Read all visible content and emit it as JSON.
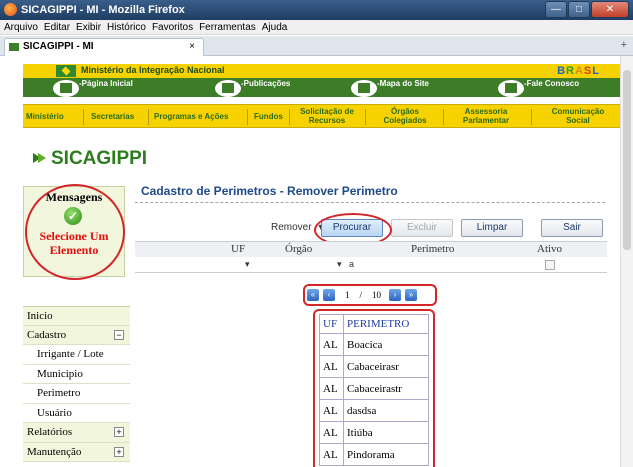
{
  "window": {
    "title": "SICAGIPPI - MI - Mozilla Firefox",
    "buttons": {
      "minimize": "—",
      "maximize": "□",
      "close": "✕"
    }
  },
  "menubar": [
    "Arquivo",
    "Editar",
    "Exibir",
    "Histórico",
    "Favoritos",
    "Ferramentas",
    "Ajuda"
  ],
  "tab": {
    "label": "SICAGIPPI - MI",
    "close": "×",
    "new_tab": "+"
  },
  "gov": {
    "ministry": "Ministério da Integração Nacional",
    "brand": [
      "B",
      "R",
      "A",
      "S",
      "L"
    ],
    "nav": [
      "-Página Inicial",
      "-Publicações",
      "-Mapa do Site",
      "-Fale Conosco"
    ]
  },
  "section_nav": [
    "Ministério",
    "Secretarias",
    "Programas e Ações",
    "Fundos",
    "Solicitação de Recursos",
    "Órgãos Colegiados",
    "Assessoria Parlamentar",
    "Comunicação Social"
  ],
  "logo": {
    "text": "SICAGIPPI"
  },
  "messages": {
    "title": "Mensagens",
    "text": "Selecione Um Elemento"
  },
  "left_menu": [
    {
      "label": "Inicio",
      "sub": false,
      "toggle": ""
    },
    {
      "label": "Cadastro",
      "sub": false,
      "toggle": "−"
    },
    {
      "label": "Irrigante / Lote",
      "sub": true,
      "toggle": ""
    },
    {
      "label": "Municipio",
      "sub": true,
      "toggle": ""
    },
    {
      "label": "Perimetro",
      "sub": true,
      "toggle": ""
    },
    {
      "label": "Usuário",
      "sub": true,
      "toggle": ""
    },
    {
      "label": "Relatórios",
      "sub": false,
      "toggle": "+"
    },
    {
      "label": "Manutenção",
      "sub": false,
      "toggle": "+"
    }
  ],
  "main": {
    "title": "Cadastro de Perimetros - Remover Perimetro",
    "action_select": "Remover",
    "buttons": {
      "procurar": "Procurar",
      "excluir": "Excluir",
      "limpar": "Limpar",
      "sair": "Sair"
    },
    "filter_headers": {
      "uf": "UF",
      "orgao": "Órgão",
      "perimetro": "Perimetro",
      "ativo": "Ativo"
    },
    "filter_values": {
      "uf": "",
      "orgao": "",
      "perimetro": "a"
    },
    "pager": {
      "current": "1",
      "separator": "/",
      "total": "10"
    },
    "table": {
      "headers": [
        "UF",
        "PERIMETRO"
      ],
      "rows": [
        [
          "AL",
          "Boacica"
        ],
        [
          "AL",
          "Cabaceirasr"
        ],
        [
          "AL",
          "Cabaceirastr"
        ],
        [
          "AL",
          "dasdsa"
        ],
        [
          "AL",
          "Itiúba"
        ],
        [
          "AL",
          "Pindorama"
        ]
      ]
    }
  },
  "colors": {
    "gov_yellow": "#f6d300",
    "gov_green": "#3d7d28",
    "highlight_red": "#d2262a",
    "title_blue": "#1e4a8a"
  }
}
